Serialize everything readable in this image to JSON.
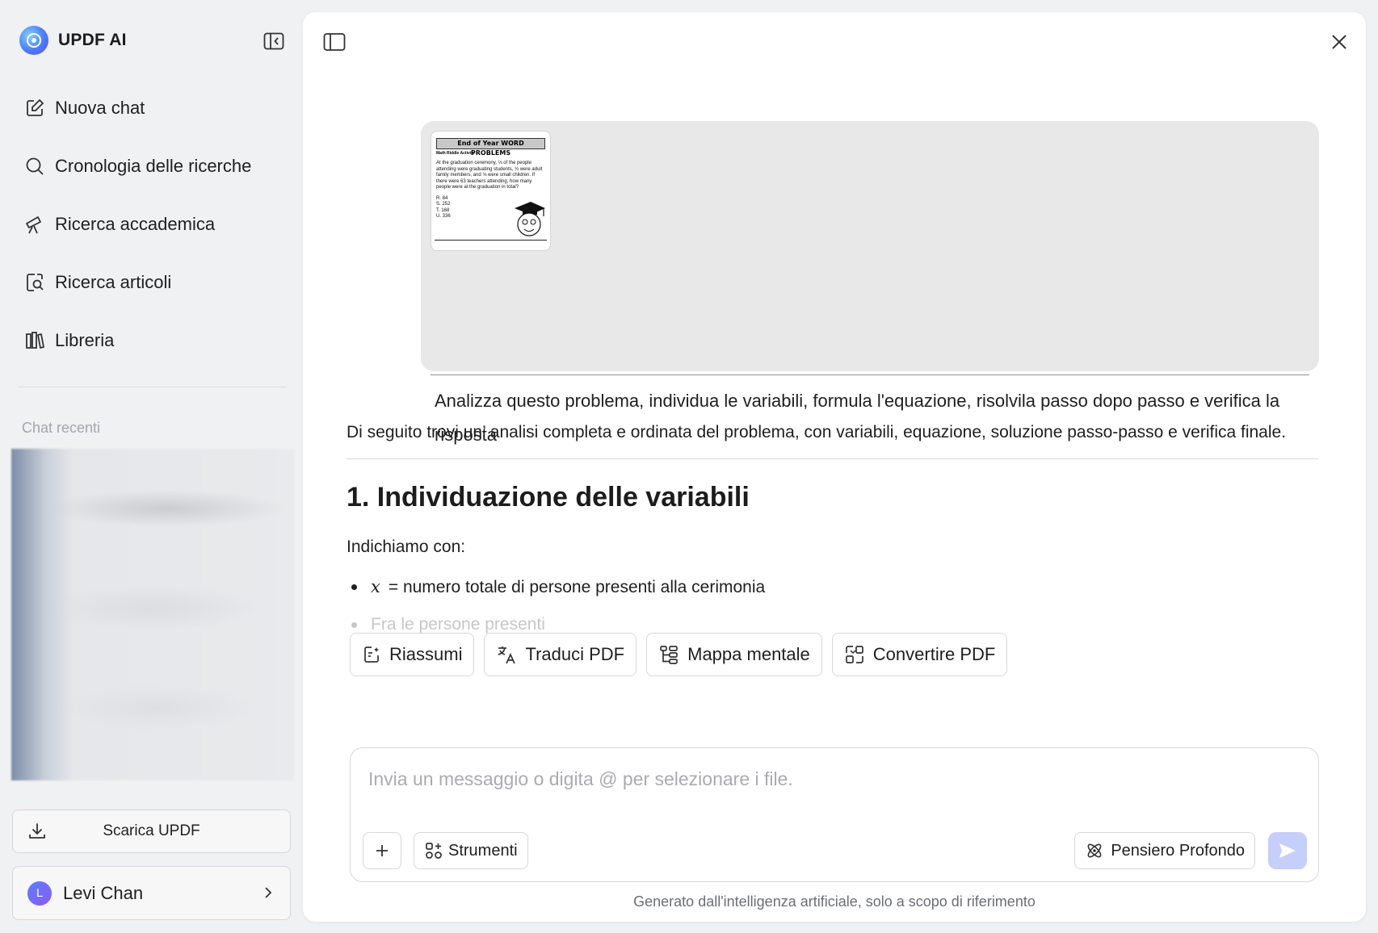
{
  "app": {
    "title": "UPDF AI"
  },
  "sidebar": {
    "items": [
      {
        "label": "Nuova chat",
        "icon": "edit-icon"
      },
      {
        "label": "Cronologia delle ricerche",
        "icon": "search-icon"
      },
      {
        "label": "Ricerca accademica",
        "icon": "telescope-icon"
      },
      {
        "label": "Ricerca articoli",
        "icon": "article-search-icon"
      },
      {
        "label": "Libreria",
        "icon": "library-icon"
      }
    ],
    "recent_title": "Chat recenti",
    "download_label": "Scarica UPDF",
    "user": {
      "initial": "L",
      "name": "Levi Chan"
    }
  },
  "conversation": {
    "user_message": {
      "attachment": {
        "title": "End of Year WORD PROBLEMS",
        "subtitle": "Math Riddle Activity",
        "body": "At the graduation ceremony, ⅓ of the people attending were graduating students, ½ were adult family members, and ⅛ were small children. If there were 63 teachers attending, how many people were at the graduation in total?",
        "options": [
          "R. 84",
          "S. 252",
          "T. 168",
          "U. 336"
        ]
      },
      "text": "Analizza questo problema, individua le variabili, formula l'equazione, risolvila passo dopo passo e verifica la risposta"
    },
    "answer": {
      "intro": "Di seguito trovi un’ analisi completa e ordinata del problema, con variabili, equazione, soluzione passo-passo e verifica finale.",
      "heading": "1. Individuazione delle variabili",
      "lead": "Indichiamo con:",
      "bullets": [
        {
          "var": "x",
          "text": "= numero totale di persone presenti alla cerimonia"
        },
        {
          "var": "",
          "text": "Fra le persone presenti"
        }
      ]
    }
  },
  "quick_actions": [
    {
      "label": "Riassumi",
      "icon": "summary-icon"
    },
    {
      "label": "Traduci PDF",
      "icon": "translate-icon"
    },
    {
      "label": "Mappa mentale",
      "icon": "mindmap-icon"
    },
    {
      "label": "Convertire PDF",
      "icon": "convert-icon"
    }
  ],
  "composer": {
    "placeholder": "Invia un messaggio o digita @ per selezionare i file.",
    "tools_label": "Strumenti",
    "deep_label": "Pensiero Profondo"
  },
  "footer": {
    "disclaimer": "Generato dall'intelligenza artificiale, solo a scopo di riferimento"
  },
  "colors": {
    "send_button": "#c6cefc",
    "brand_gradient_start": "#7fd0ff",
    "brand_gradient_end": "#6b4cf0"
  }
}
